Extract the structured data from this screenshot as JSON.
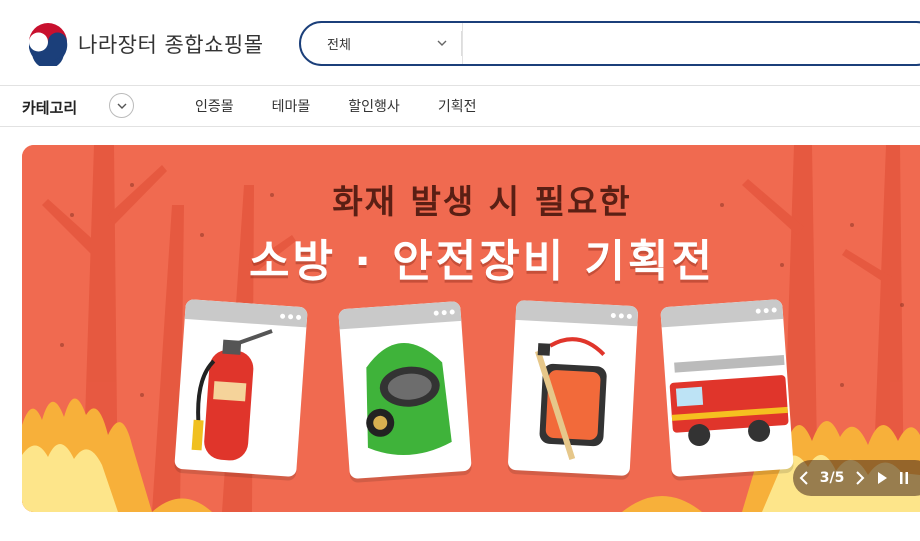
{
  "header": {
    "site_title": "나라장터 종합쇼핑몰",
    "search": {
      "scope_selected": "전체",
      "query": ""
    }
  },
  "nav": {
    "category_label": "카테고리",
    "menu": [
      "인증몰",
      "테마몰",
      "할인행사",
      "기획전"
    ]
  },
  "banner": {
    "headline": "화재 발생 시 필요한",
    "title": "소방 · 안전장비 기획전",
    "products": [
      "fire-extinguisher-icon",
      "gas-mask-icon",
      "fire-hose-reel-icon",
      "fire-truck-icon"
    ],
    "slide": {
      "current": "3",
      "total": "5",
      "separator": "/"
    }
  },
  "colors": {
    "brand_navy": "#1b3f7a",
    "banner_bg": "#f06a50",
    "headline": "#5a1f14"
  }
}
